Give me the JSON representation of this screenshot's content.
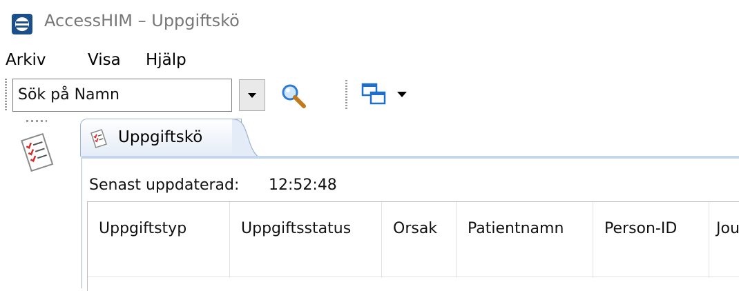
{
  "window": {
    "title": "AccessHIM – Uppgiftskö",
    "icon": "accesshim-logo-icon"
  },
  "menu": {
    "items": [
      "Arkiv",
      "Visa",
      "Hjälp"
    ]
  },
  "toolbar": {
    "search_value": "Sök på Namn",
    "icons": [
      "dropdown-arrow-icon",
      "magnifier-icon",
      "windows-icon",
      "chevron-down-icon"
    ]
  },
  "sidebar": {
    "icon": "task-list-icon"
  },
  "tab": {
    "label": "Uppgiftskö",
    "icon": "task-list-icon"
  },
  "status": {
    "label": "Senast uppdaterad:",
    "time": "12:52:48"
  },
  "table": {
    "columns": [
      "Uppgiftstyp",
      "Uppgiftsstatus",
      "Orsak",
      "Patientnamn",
      "Person-ID",
      "Jou"
    ]
  },
  "colors": {
    "accent": "#1b4f8a",
    "tab_border": "#9db2cf"
  }
}
